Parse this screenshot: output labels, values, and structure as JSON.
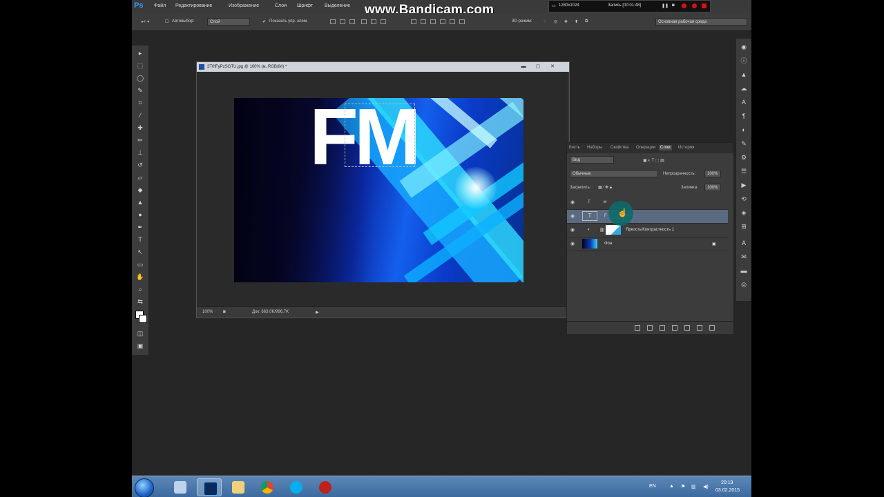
{
  "menubar": {
    "app_logo": "Ps",
    "items": [
      "Файл",
      "Редактирование",
      "Изображение",
      "Слои",
      "Шрифт",
      "Выделение"
    ]
  },
  "overlay": {
    "watermark": "www.Bandicam.com",
    "rec_resolution": "1280x1024",
    "rec_label": "Запись [00:01:48]"
  },
  "options": {
    "autoselect_label": "Автовыбор:",
    "autoselect_value": "Слой",
    "show_controls_label": "Показать упр. элем.",
    "mode_3d_label": "3D-режим:",
    "workspace_value": "Основная рабочая среда"
  },
  "document": {
    "title": "3T0fFyPzSGTU.jpg @ 100% (м, RGB/8#) *",
    "zoom": "100%",
    "doc_size": "Док: 663,0K/996,7K",
    "artwork_text": "FM"
  },
  "layers_panel": {
    "tabs": [
      "Кисть",
      "Наборы",
      "Свойства",
      "Операции",
      "Слои",
      "История"
    ],
    "active_tab": "Слои",
    "filter_kind": "Вид",
    "blend_mode": "Обычные",
    "opacity_label": "Непрозрачность:",
    "opacity_value": "100%",
    "lock_label": "Закрепить:",
    "fill_label": "Заливка:",
    "fill_value": "100%",
    "layers": [
      {
        "name": "м",
        "type": "text"
      },
      {
        "name": "F",
        "type": "text"
      },
      {
        "name": "Яркость/Контрастность 1",
        "type": "adjustment"
      },
      {
        "name": "Фон",
        "type": "image"
      }
    ]
  },
  "taskbar": {
    "language": "EN",
    "time": "20:19",
    "date": "03.02.2015"
  },
  "colors": {
    "ps_blue": "#2fa4ff",
    "panel_bg": "#3c3c3c",
    "workspace_bg": "#262626",
    "selected_layer": "#5a6a80",
    "record_red": "#d81010"
  }
}
